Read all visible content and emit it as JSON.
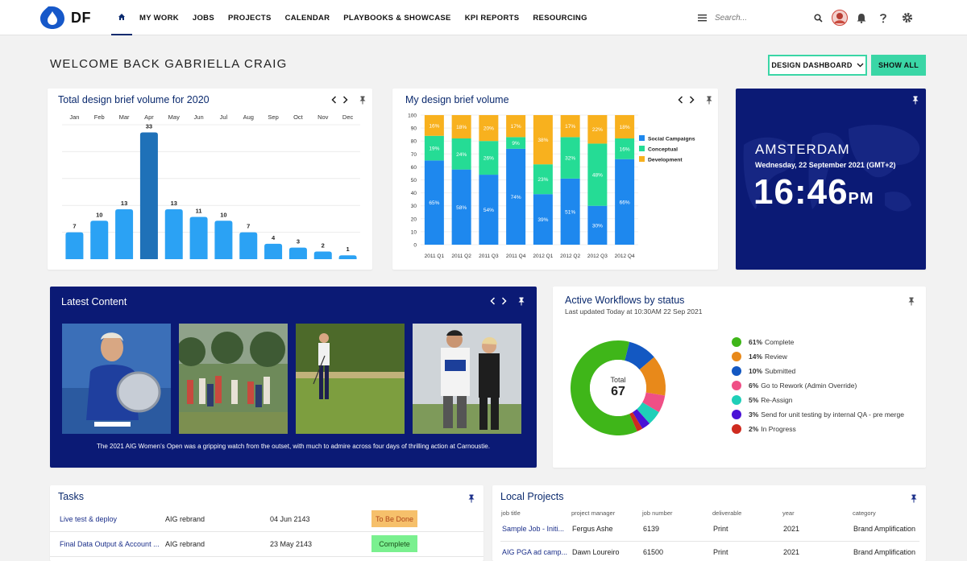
{
  "nav": {
    "brand": "DF",
    "items": [
      "MY WORK",
      "JOBS",
      "PROJECTS",
      "CALENDAR",
      "PLAYBOOKS & SHOWCASE",
      "KPI REPORTS",
      "RESOURCING"
    ],
    "search_placeholder": "Search..."
  },
  "welcome": "WELCOME BACK GABRIELLA CRAIG",
  "dashboard_select": "DESIGN DASHBOARD",
  "show_all": "SHOW ALL",
  "brief_volume": {
    "title": "Total design brief volume for 2020"
  },
  "my_brief": {
    "title": "My design brief volume"
  },
  "clock": {
    "city": "AMSTERDAM",
    "date": "Wednesday, 22 September 2021 (GMT+2)",
    "time": "16:46",
    "ampm": "PM"
  },
  "latest": {
    "title": "Latest Content",
    "caption": "The 2021 AIG Women’s Open was a gripping watch from the outset, with much to admire across four days of thrilling action at Carnoustie."
  },
  "workflows": {
    "title": "Active Workflows by status",
    "updated": "Last updated Today at 10:30AM 22 Sep 2021",
    "total_label": "Total",
    "total": "67",
    "legend": [
      {
        "pct": "61%",
        "label": "Complete",
        "color": "#3fb619"
      },
      {
        "pct": "14%",
        "label": "Review",
        "color": "#e8891a"
      },
      {
        "pct": "10%",
        "label": "Submitted",
        "color": "#1358c2"
      },
      {
        "pct": "6%",
        "label": "Go to Rework (Admin Override)",
        "color": "#ef4f86"
      },
      {
        "pct": "5%",
        "label": "Re-Assign",
        "color": "#1fcfb8"
      },
      {
        "pct": "3%",
        "label": "Send for unit testing by internal QA - pre merge",
        "color": "#4a12d6"
      },
      {
        "pct": "2%",
        "label": "In Progress",
        "color": "#cf2b1f"
      }
    ]
  },
  "tasks": {
    "title": "Tasks",
    "rows": [
      {
        "name": "Live test & deploy",
        "project": "AIG rebrand",
        "date": "04 Jun 2143",
        "status": "To Be Done",
        "status_bg": "#f6c06b",
        "status_color": "#b0451a"
      },
      {
        "name": "Final Data Output & Account ...",
        "project": "AIG rebrand",
        "date": "23 May 2143",
        "status": "Complete",
        "status_bg": "#7af08f",
        "status_color": "#1a4d1a"
      }
    ]
  },
  "projects": {
    "title": "Local Projects",
    "headers": [
      "job title",
      "project manager",
      "job number",
      "deliverable",
      "year",
      "category"
    ],
    "rows": [
      [
        "Sample Job - Initi...",
        "Fergus Ashe",
        "6139",
        "Print",
        "2021",
        "Brand Amplification"
      ],
      [
        "AIG PGA ad camp...",
        "Dawn Loureiro",
        "61500",
        "Print",
        "2021",
        "Brand Amplification"
      ]
    ]
  },
  "chart_data": [
    {
      "type": "bar",
      "title": "Total design brief volume for 2020",
      "categories": [
        "Jan",
        "Feb",
        "Mar",
        "Apr",
        "May",
        "Jun",
        "Jul",
        "Aug",
        "Sep",
        "Oct",
        "Nov",
        "Dec"
      ],
      "values": [
        7,
        10,
        13,
        33,
        13,
        11,
        10,
        7,
        4,
        3,
        2,
        1
      ],
      "highlight_index": 3,
      "colors": {
        "bar": "#2ba2f4",
        "highlight": "#1f71b8"
      },
      "grid": true
    },
    {
      "type": "bar",
      "stacked": true,
      "title": "My design brief volume",
      "categories": [
        "2011 Q1",
        "2011 Q2",
        "2011 Q3",
        "2011 Q4",
        "2012 Q1",
        "2012 Q2",
        "2012 Q3",
        "2012 Q4"
      ],
      "ylim": [
        0,
        100
      ],
      "yticks": [
        0,
        10,
        20,
        30,
        40,
        50,
        60,
        70,
        80,
        90,
        100
      ],
      "legend_position": "right",
      "series": [
        {
          "name": "Social Campaigns",
          "color": "#1e88ee",
          "values": [
            65,
            58,
            54,
            74,
            39,
            51,
            30,
            66
          ]
        },
        {
          "name": "Conceptual",
          "color": "#25dc95",
          "values": [
            19,
            24,
            26,
            9,
            23,
            32,
            48,
            16
          ]
        },
        {
          "name": "Development",
          "color": "#f8b11e",
          "values": [
            16,
            18,
            20,
            17,
            38,
            17,
            22,
            18
          ]
        }
      ]
    },
    {
      "type": "pie",
      "title": "Active Workflows by status",
      "donut": true,
      "categories": [
        "Complete",
        "Review",
        "Submitted",
        "Go to Rework (Admin Override)",
        "Re-Assign",
        "Send for unit testing by internal QA - pre merge",
        "In Progress"
      ],
      "values": [
        61,
        14,
        10,
        6,
        5,
        3,
        2
      ],
      "colors": [
        "#3fb619",
        "#e8891a",
        "#1358c2",
        "#ef4f86",
        "#1fcfb8",
        "#4a12d6",
        "#cf2b1f"
      ]
    }
  ]
}
